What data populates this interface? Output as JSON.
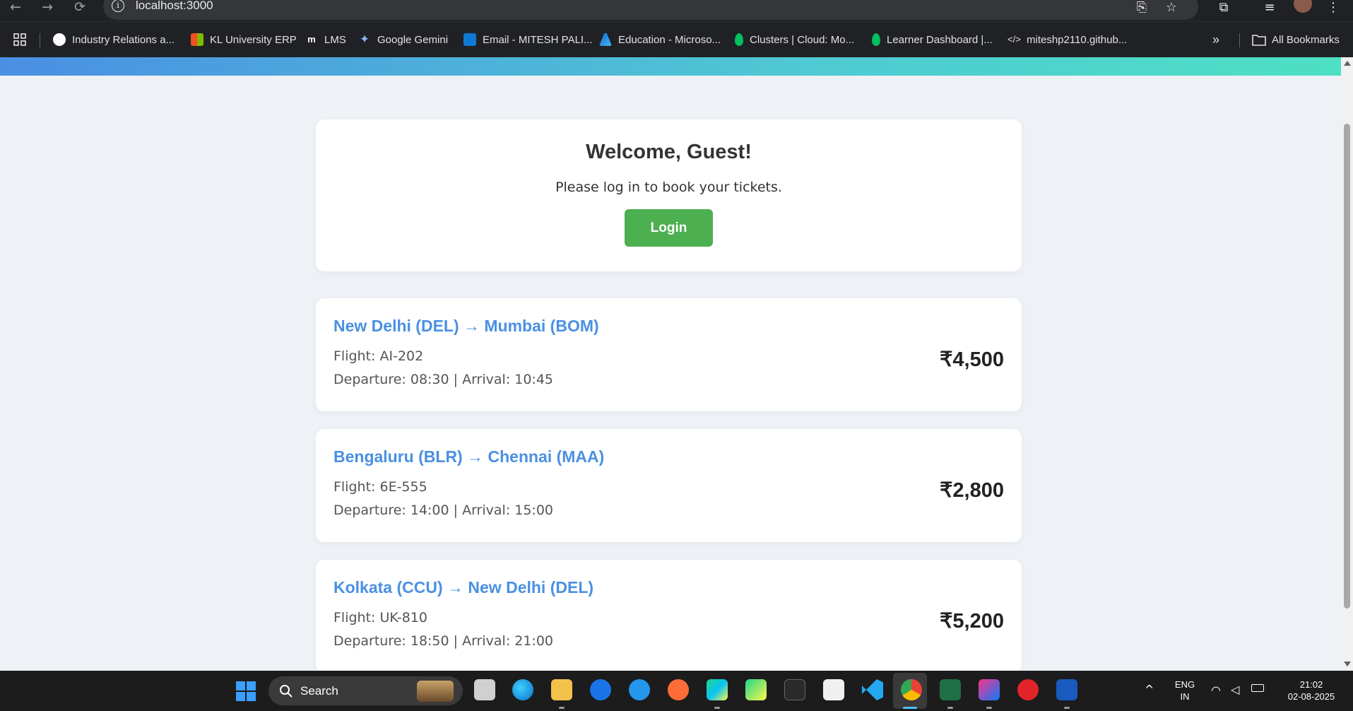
{
  "browser": {
    "url": "localhost:3000",
    "bookmarks": [
      {
        "label": "Industry Relations a...",
        "icon": "globe-icon"
      },
      {
        "label": "KL University ERP",
        "icon": "microsoft-icon"
      },
      {
        "label": "LMS",
        "icon": "moodle-icon"
      },
      {
        "label": "Google Gemini",
        "icon": "gemini-icon"
      },
      {
        "label": "Email - MITESH PALI...",
        "icon": "outlook-icon"
      },
      {
        "label": "Education - Microso...",
        "icon": "azure-icon"
      },
      {
        "label": "Clusters | Cloud: Mo...",
        "icon": "mongodb-icon"
      },
      {
        "label": "Learner Dashboard |...",
        "icon": "mongodb-icon"
      },
      {
        "label": "miteshp2110.github...",
        "icon": "code-icon"
      }
    ],
    "all_bookmarks_label": "All Bookmarks"
  },
  "welcome": {
    "title": "Welcome, Guest!",
    "message": "Please log in to book your tickets.",
    "login_label": "Login"
  },
  "flights": [
    {
      "route": "New Delhi (DEL) → Mumbai (BOM)",
      "flight": "Flight: AI-202",
      "times": "Departure: 08:30 | Arrival: 10:45",
      "price": "₹4,500"
    },
    {
      "route": "Bengaluru (BLR) → Chennai (MAA)",
      "flight": "Flight: 6E-555",
      "times": "Departure: 14:00 | Arrival: 15:00",
      "price": "₹2,800"
    },
    {
      "route": "Kolkata (CCU) → New Delhi (DEL)",
      "flight": "Flight: UK-810",
      "times": "Departure: 18:50 | Arrival: 21:00",
      "price": "₹5,200"
    }
  ],
  "taskbar": {
    "search_label": "Search",
    "language": "ENG",
    "region": "IN",
    "time": "21:02",
    "date": "02-08-2025"
  }
}
